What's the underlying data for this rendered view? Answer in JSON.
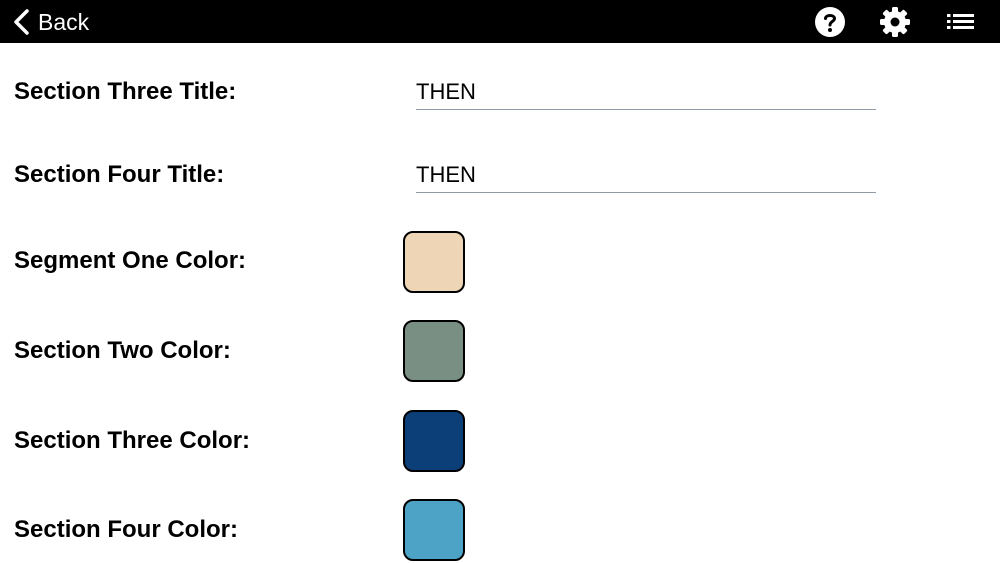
{
  "topbar": {
    "back_label": "Back",
    "icons": [
      "help-icon",
      "gear-icon",
      "list-icon"
    ]
  },
  "fields": {
    "section_three_title": {
      "label": "Section Three Title:",
      "value": "THEN"
    },
    "section_four_title": {
      "label": "Section Four Title:",
      "value": "THEN"
    }
  },
  "colors": {
    "segment_one": {
      "label": "Segment One Color:",
      "color": "#EDD5B5"
    },
    "section_two": {
      "label": "Section Two Color:",
      "color": "#7A8F83"
    },
    "section_three": {
      "label": "Section Three Color:",
      "color": "#0C3F78"
    },
    "section_four": {
      "label": "Section Four Color:",
      "color": "#4CA3C6"
    }
  }
}
